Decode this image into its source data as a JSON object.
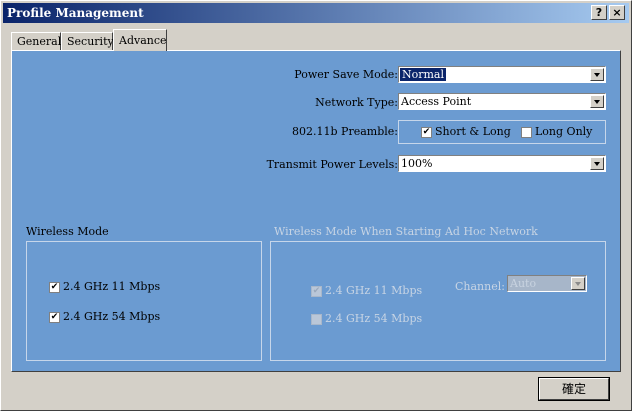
{
  "window": {
    "title": "Profile Management",
    "help_label": "?",
    "close_label": "×"
  },
  "tabs": [
    {
      "label": "General",
      "active": false
    },
    {
      "label": "Security",
      "active": false
    },
    {
      "label": "Advance",
      "active": true
    }
  ],
  "settings": {
    "power_save_mode": {
      "label": "Power Save Mode:",
      "value": "Normal"
    },
    "network_type": {
      "label": "Network Type:",
      "value": "Access Point"
    },
    "preamble": {
      "label": "802.11b Preamble:",
      "options": [
        {
          "label": "Short & Long",
          "checked": true
        },
        {
          "label": "Long Only",
          "checked": false
        }
      ]
    },
    "transmit_power": {
      "label": "Transmit Power Levels:",
      "value": "100%"
    }
  },
  "wireless_mode": {
    "title": "Wireless Mode",
    "options": [
      {
        "label": "2.4 GHz 11 Mbps",
        "checked": true
      },
      {
        "label": "2.4 GHz 54 Mbps",
        "checked": true
      }
    ]
  },
  "adhoc_mode": {
    "title": "Wireless Mode When Starting Ad Hoc Network",
    "options": [
      {
        "label": "2.4 GHz 11 Mbps",
        "checked": true
      },
      {
        "label": "2.4 GHz 54 Mbps",
        "checked": false
      }
    ],
    "channel_label": "Channel:",
    "channel_value": "Auto"
  },
  "ok_button": "確定"
}
